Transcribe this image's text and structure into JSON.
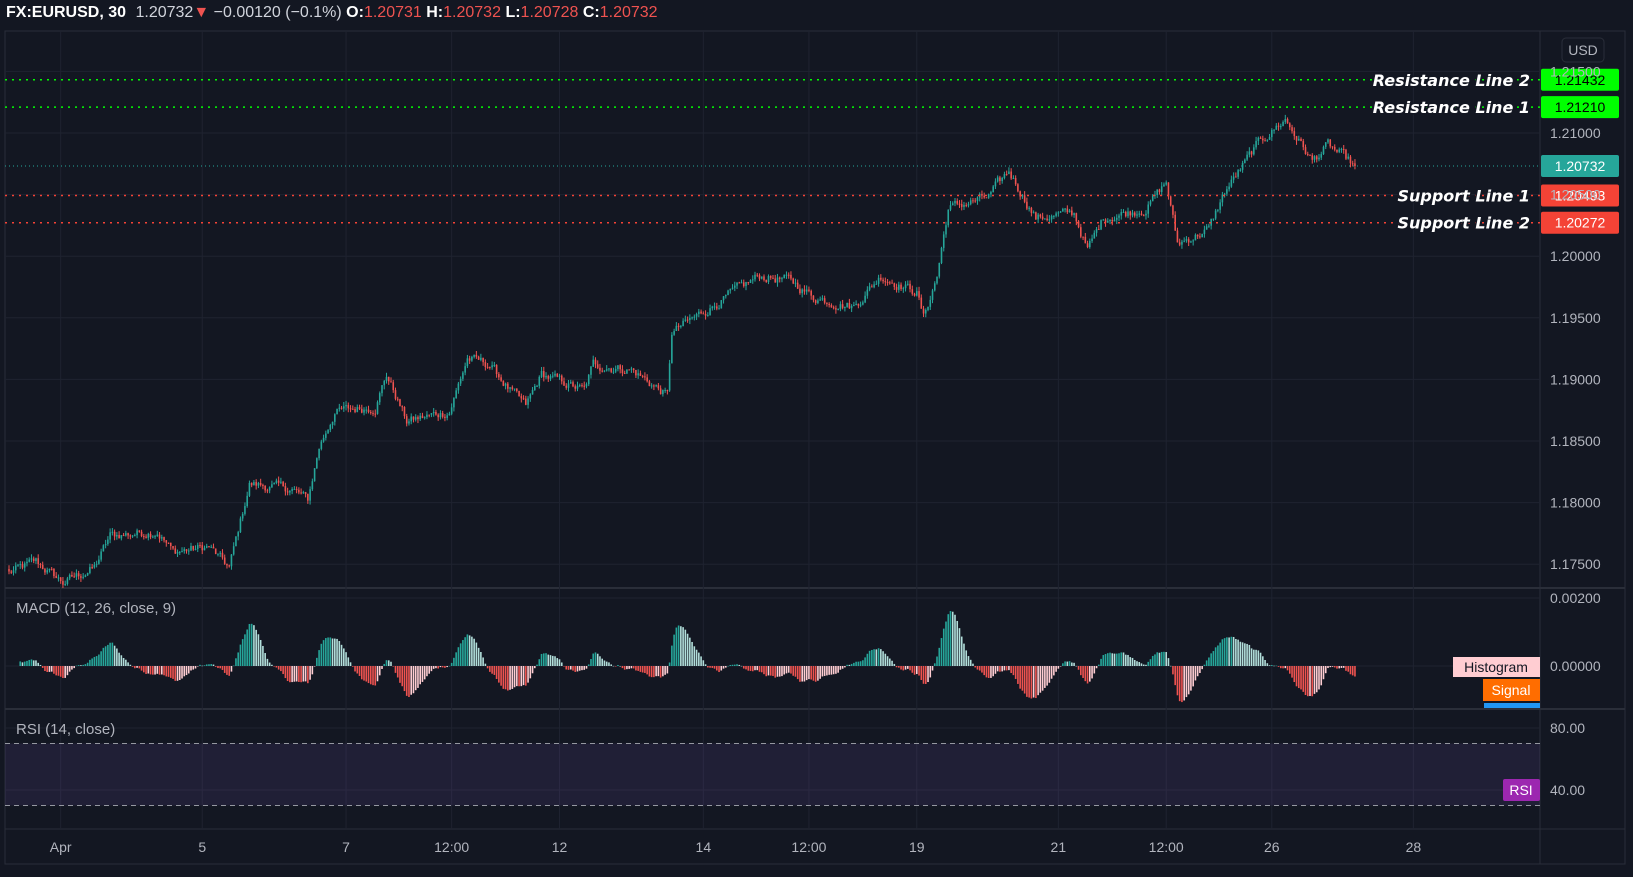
{
  "header": {
    "symbol": "FX:EURUSD, 30",
    "last": "1.20732",
    "change": "−0.00120 (−0.1%)",
    "o_label": "O:",
    "o": "1.20731",
    "h_label": "H:",
    "h": "1.20732",
    "l_label": "L:",
    "l": "1.20728",
    "c_label": "C:",
    "c": "1.20732",
    "direction_icon": "triangle-down-icon"
  },
  "colors": {
    "background": "#131722",
    "up": "#26a69a",
    "down": "#ef5350",
    "resistance": "#00ff00",
    "support": "#f44336",
    "last": "#26a69a",
    "macd": "#2196f3",
    "signal": "#ff6d00",
    "rsi": "#9c27b0"
  },
  "chart_data": [
    {
      "type": "candlestick",
      "title": "FX:EURUSD, 30",
      "currency_label": "USD",
      "ylim": [
        1.1725,
        1.2175
      ],
      "y_ticks": [
        "1.21500",
        "1.21000",
        "1.20500",
        "1.20000",
        "1.19500",
        "1.19000",
        "1.18500",
        "1.18000",
        "1.17500"
      ],
      "y_tick_values": [
        1.215,
        1.21,
        1.205,
        1.2,
        1.195,
        1.19,
        1.185,
        1.18,
        1.175
      ],
      "x_ticks": [
        {
          "label": "Apr",
          "bar": 23
        },
        {
          "label": "5",
          "bar": 86
        },
        {
          "label": "7",
          "bar": 150
        },
        {
          "label": "12:00",
          "bar": 197
        },
        {
          "label": "12",
          "bar": 245
        },
        {
          "label": "14",
          "bar": 309
        },
        {
          "label": "12:00",
          "bar": 356
        },
        {
          "label": "19",
          "bar": 404
        },
        {
          "label": "21",
          "bar": 467
        },
        {
          "label": "12:00",
          "bar": 515
        },
        {
          "label": "26",
          "bar": 562
        },
        {
          "label": "28",
          "bar": 625
        }
      ],
      "bar_count": 600,
      "close_waypoints": [
        [
          0,
          1.1743
        ],
        [
          12,
          1.1752
        ],
        [
          24,
          1.1735
        ],
        [
          38,
          1.1747
        ],
        [
          45,
          1.1773
        ],
        [
          66,
          1.1777
        ],
        [
          73,
          1.176
        ],
        [
          89,
          1.1764
        ],
        [
          98,
          1.1747
        ],
        [
          107,
          1.1815
        ],
        [
          126,
          1.1811
        ],
        [
          133,
          1.1802
        ],
        [
          138,
          1.1845
        ],
        [
          145,
          1.1874
        ],
        [
          163,
          1.1878
        ],
        [
          168,
          1.1904
        ],
        [
          177,
          1.1866
        ],
        [
          196,
          1.1874
        ],
        [
          204,
          1.1917
        ],
        [
          214,
          1.1912
        ],
        [
          223,
          1.1891
        ],
        [
          230,
          1.1878
        ],
        [
          237,
          1.1904
        ],
        [
          256,
          1.1891
        ],
        [
          260,
          1.1912
        ],
        [
          277,
          1.1908
        ],
        [
          293,
          1.1887
        ],
        [
          295,
          1.1938
        ],
        [
          316,
          1.1963
        ],
        [
          334,
          1.1984
        ],
        [
          348,
          1.198
        ],
        [
          358,
          1.1967
        ],
        [
          376,
          1.1959
        ],
        [
          388,
          1.1984
        ],
        [
          404,
          1.1971
        ],
        [
          407,
          1.195
        ],
        [
          413,
          1.1984
        ],
        [
          418,
          1.2039
        ],
        [
          436,
          1.2048
        ],
        [
          445,
          1.2069
        ],
        [
          457,
          1.2031
        ],
        [
          474,
          1.2035
        ],
        [
          480,
          1.2005
        ],
        [
          487,
          1.2031
        ],
        [
          506,
          1.2039
        ],
        [
          515,
          1.206
        ],
        [
          520,
          1.201
        ],
        [
          534,
          1.2022
        ],
        [
          541,
          1.2052
        ],
        [
          557,
          1.2094
        ],
        [
          568,
          1.2111
        ],
        [
          580,
          1.2077
        ],
        [
          587,
          1.209
        ],
        [
          599,
          1.20732
        ]
      ],
      "levels": [
        {
          "name": "Resistance Line 2",
          "value": "1.21432",
          "kind": "resistance"
        },
        {
          "name": "Resistance Line 1",
          "value": "1.21210",
          "kind": "resistance"
        },
        {
          "name": "Support Line 1",
          "value": "1.20493",
          "kind": "support"
        },
        {
          "name": "Support Line 2",
          "value": "1.20272",
          "kind": "support"
        }
      ],
      "last_price": "1.20732"
    },
    {
      "type": "line",
      "title": "MACD (12, 26, close, 9)",
      "series": [
        {
          "name": "MACD"
        },
        {
          "name": "Signal"
        },
        {
          "name": "Histogram"
        }
      ],
      "legend_labels": {
        "histogram": "Histogram",
        "signal": "Signal"
      },
      "y_ticks": [
        "0.00200",
        "0.00000"
      ],
      "y_tick_values": [
        0.002,
        0
      ]
    },
    {
      "type": "line",
      "title": "RSI (14, close)",
      "legend_label": "RSI",
      "y_ticks": [
        "80.00",
        "40.00"
      ],
      "y_tick_values": [
        80,
        40
      ],
      "bands": [
        70,
        30
      ]
    }
  ]
}
